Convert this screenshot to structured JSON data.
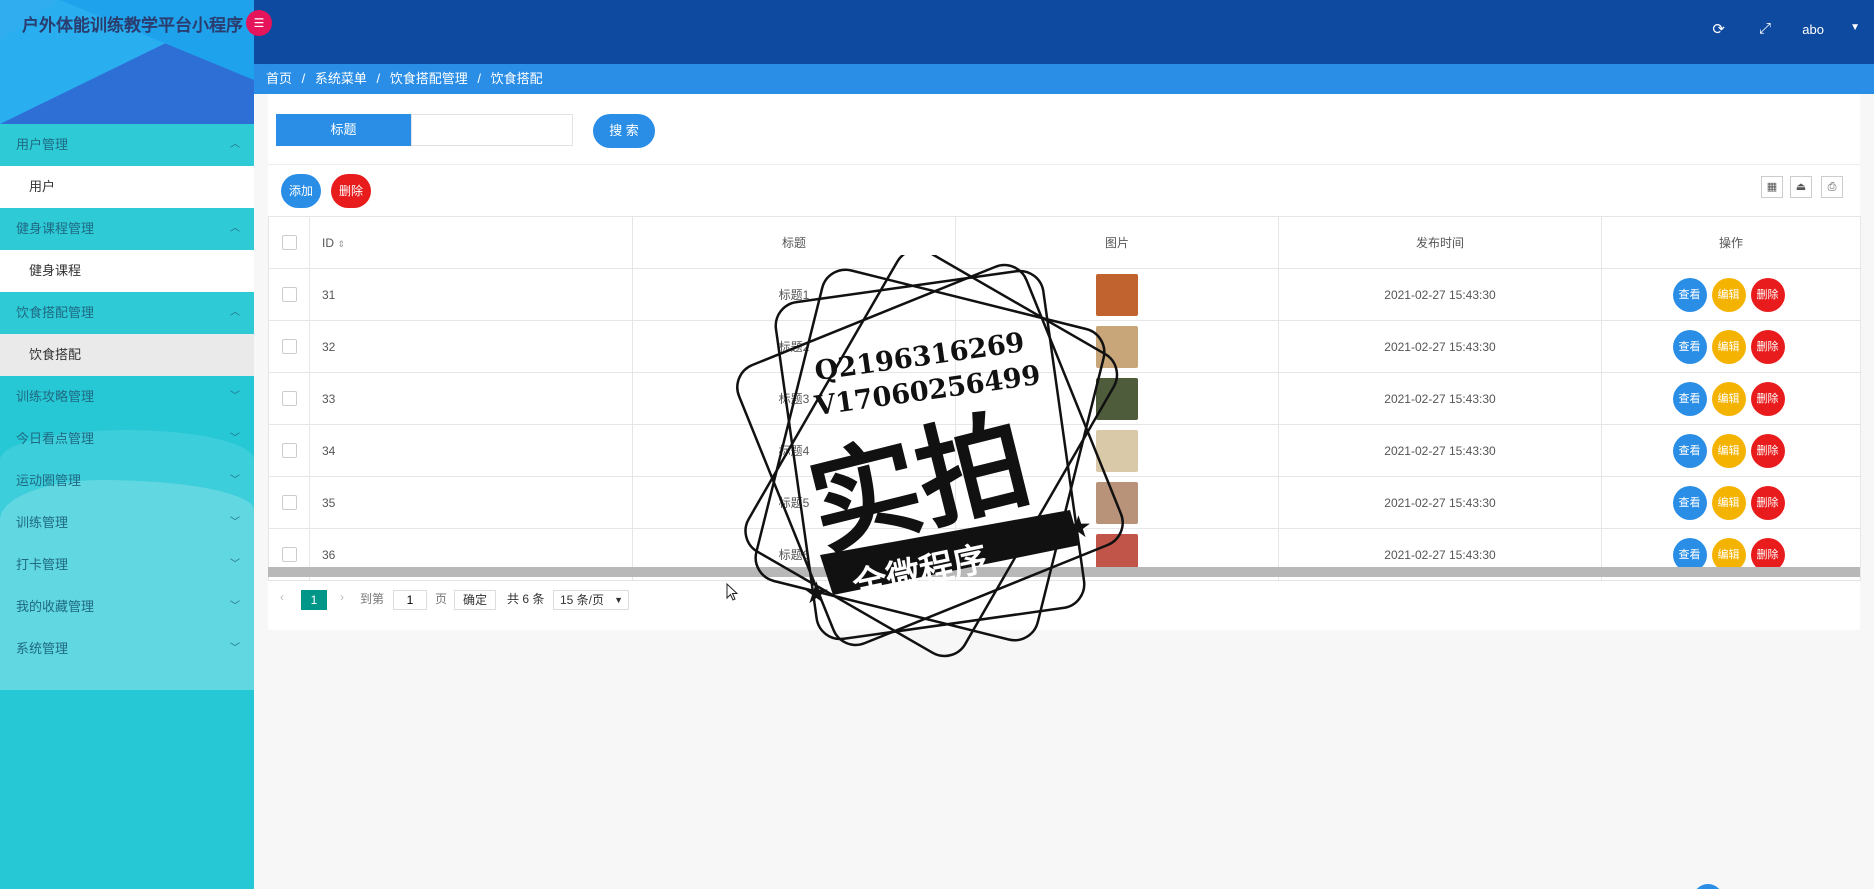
{
  "app": {
    "title": "户外体能训练教学平台小程序",
    "badge_icon": "menu-list-icon"
  },
  "sidebar": {
    "groups": [
      {
        "label": "用户管理",
        "open": true,
        "items": [
          {
            "label": "用户"
          }
        ]
      },
      {
        "label": "健身课程管理",
        "open": true,
        "items": [
          {
            "label": "健身课程"
          }
        ]
      },
      {
        "label": "饮食搭配管理",
        "open": true,
        "items": [
          {
            "label": "饮食搭配"
          }
        ]
      },
      {
        "label": "训练攻略管理",
        "open": false
      },
      {
        "label": "今日看点管理",
        "open": false
      },
      {
        "label": "运动圈管理",
        "open": false
      },
      {
        "label": "训练管理",
        "open": false
      },
      {
        "label": "打卡管理",
        "open": false
      },
      {
        "label": "我的收藏管理",
        "open": false
      },
      {
        "label": "系统管理",
        "open": false
      }
    ]
  },
  "topbar": {
    "user": "abo",
    "icons": [
      "refresh-icon",
      "fullscreen-icon"
    ]
  },
  "breadcrumb": [
    "首页",
    "/",
    "系统菜单",
    "/",
    "饮食搭配管理",
    "/",
    "饮食搭配"
  ],
  "search": {
    "label": "标题",
    "value": "",
    "button": "搜 索"
  },
  "actions": {
    "add": "添加",
    "delete": "删除"
  },
  "table": {
    "headers": {
      "id": "ID",
      "title": "标题",
      "image": "图片",
      "time": "发布时间",
      "ops": "操作"
    },
    "rows": [
      {
        "id": "31",
        "title": "标题1",
        "time": "2021-02-27 15:43:30",
        "img_color": "#c0632f"
      },
      {
        "id": "32",
        "title": "标题2",
        "time": "2021-02-27 15:43:30",
        "img_color": "#c9a57a"
      },
      {
        "id": "33",
        "title": "标题3",
        "time": "2021-02-27 15:43:30",
        "img_color": "#4f5c3b"
      },
      {
        "id": "34",
        "title": "标题4",
        "time": "2021-02-27 15:43:30",
        "img_color": "#d9c9a8"
      },
      {
        "id": "35",
        "title": "标题5",
        "time": "2021-02-27 15:43:30",
        "img_color": "#b8937a"
      },
      {
        "id": "36",
        "title": "标题6",
        "time": "2021-02-27 15:43:30",
        "img_color": "#c2554a"
      }
    ],
    "row_ops": {
      "view": "查看",
      "edit": "编辑",
      "delete": "删除"
    }
  },
  "pager": {
    "current": "1",
    "goto_label": "到第",
    "goto_value": "1",
    "page_unit": "页",
    "confirm": "确定",
    "total": "共 6 条",
    "per_page": "15 条/页"
  },
  "watermark": {
    "line1": "Q2196316269",
    "line2": "V17060256499",
    "big": "实拍",
    "banner": "全微程序"
  },
  "colors": {
    "sidebar": "#27c8d5",
    "topbar": "#0f4aa1",
    "breadcrumb": "#2a8ee7",
    "primary": "#2a8ee7",
    "danger": "#e81c1c",
    "warning": "#f5b301",
    "pager_active": "#009688"
  }
}
